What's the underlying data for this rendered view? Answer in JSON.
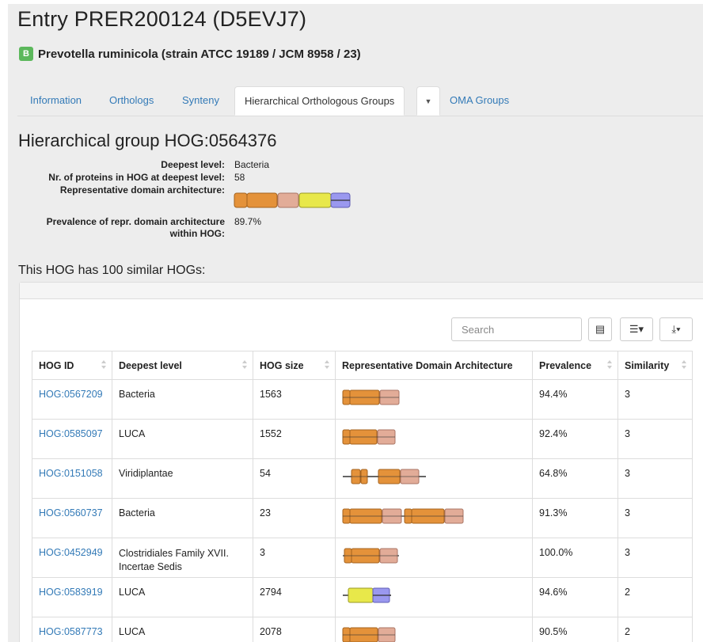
{
  "entry_title": "Entry PRER200124 (D5EVJ7)",
  "species": {
    "badge": "B",
    "name": "Prevotella ruminicola",
    "strain": "(strain ATCC 19189 / JCM 8958 / 23)"
  },
  "tabs": [
    {
      "label": "Information"
    },
    {
      "label": "Orthologs"
    },
    {
      "label": "Synteny"
    },
    {
      "label": "Hierarchical Orthologous Groups",
      "active": true
    },
    {
      "label": "OMA Groups"
    }
  ],
  "hog_heading": "Hierarchical group HOG:0564376",
  "properties": {
    "deepest_level_label": "Deepest level:",
    "deepest_level_value": "Bacteria",
    "nr_proteins_label": "Nr. of proteins in HOG at deepest level:",
    "nr_proteins_value": "58",
    "repr_arch_label": "Representative domain architecture:",
    "prevalence_label_1": "Prevalence of repr. domain architecture",
    "prevalence_label_2": "within HOG:",
    "prevalence_value": "89.7%"
  },
  "similar_heading": "This HOG has 100 similar HOGs:",
  "toolbar": {
    "search_placeholder": "Search",
    "columns_icon": "columns-icon",
    "list_icon": "list-icon",
    "download_icon": "download-icon"
  },
  "colors": {
    "orange": "#e4923a",
    "pink": "#e2ac98",
    "yellow": "#e8e84a",
    "blue": "#9a98ef",
    "link": "#337ab7",
    "badge_green": "#5cb85c"
  },
  "table": {
    "headers": [
      "HOG ID",
      "Deepest level",
      "HOG size",
      "Representative Domain Architecture",
      "Prevalence",
      "Similarity"
    ],
    "rows": [
      {
        "id": "HOG:0567209",
        "level": "Bacteria",
        "size": "1563",
        "prevalence": "94.4%",
        "similarity": "3"
      },
      {
        "id": "HOG:0585097",
        "level": "LUCA",
        "size": "1552",
        "prevalence": "92.4%",
        "similarity": "3"
      },
      {
        "id": "HOG:0151058",
        "level": "Viridiplantae",
        "size": "54",
        "prevalence": "64.8%",
        "similarity": "3"
      },
      {
        "id": "HOG:0560737",
        "level": "Bacteria",
        "size": "23",
        "prevalence": "91.3%",
        "similarity": "3"
      },
      {
        "id": "HOG:0452949",
        "level": "Clostridiales Family XVII. Incertae Sedis",
        "size": "3",
        "prevalence": "100.0%",
        "similarity": "3"
      },
      {
        "id": "HOG:0583919",
        "level": "LUCA",
        "size": "2794",
        "prevalence": "94.6%",
        "similarity": "2"
      },
      {
        "id": "HOG:0587773",
        "level": "LUCA",
        "size": "2078",
        "prevalence": "90.5%",
        "similarity": "2"
      }
    ]
  }
}
